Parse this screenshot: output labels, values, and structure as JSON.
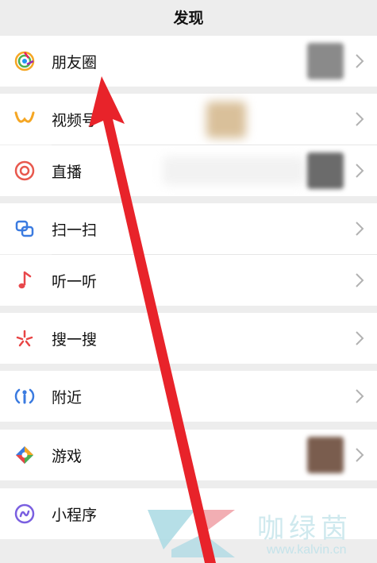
{
  "header": {
    "title": "发现"
  },
  "menu": [
    {
      "label": "朋友圈",
      "icon": "moments-icon"
    },
    {
      "label": "视频号",
      "icon": "channels-icon"
    },
    {
      "label": "直播",
      "icon": "live-icon"
    },
    {
      "label": "扫一扫",
      "icon": "scan-icon"
    },
    {
      "label": "听一听",
      "icon": "music-note-icon"
    },
    {
      "label": "搜一搜",
      "icon": "search-sparkle-icon"
    },
    {
      "label": "附近",
      "icon": "nearby-icon"
    },
    {
      "label": "游戏",
      "icon": "game-icon"
    },
    {
      "label": "小程序",
      "icon": "mini-program-icon"
    }
  ],
  "watermark": {
    "text": "咖绿茵",
    "url": "www.kalvin.cn"
  },
  "colors": {
    "arrow": "#e8232a",
    "background": "#ededed",
    "row": "#ffffff",
    "chevron": "#b2b2b2"
  }
}
